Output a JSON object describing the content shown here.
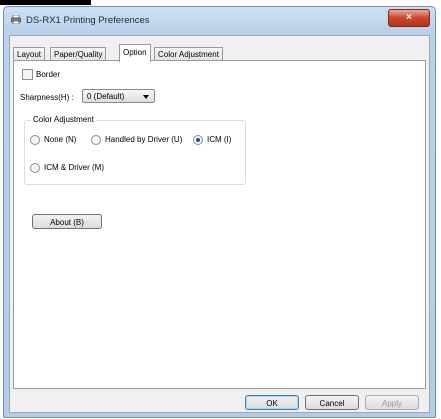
{
  "window": {
    "title": "DS-RX1 Printing Preferences",
    "close_label": "×"
  },
  "tabs": [
    {
      "label": "Layout",
      "active": false
    },
    {
      "label": "Paper/Quality",
      "active": false
    },
    {
      "label": "Option",
      "active": true
    },
    {
      "label": "Color Adjustment",
      "active": false
    }
  ],
  "option": {
    "border_label": "Border",
    "border_checked": false,
    "sharpness_label": "Sharpness(H) :",
    "sharpness_value": "0 (Default)",
    "color_adjustment": {
      "title": "Color Adjustment",
      "options": [
        {
          "label": "None (N)",
          "selected": false
        },
        {
          "label": "Handled by Driver (U)",
          "selected": false
        },
        {
          "label": "ICM (I)",
          "selected": true
        },
        {
          "label": "ICM  & Driver (M)",
          "selected": false
        }
      ]
    },
    "about_label": "About (B)"
  },
  "footer": {
    "ok": "OK",
    "cancel": "Cancel",
    "apply": "Apply"
  },
  "icons": {
    "title": "printer-icon",
    "close": "close-icon"
  }
}
